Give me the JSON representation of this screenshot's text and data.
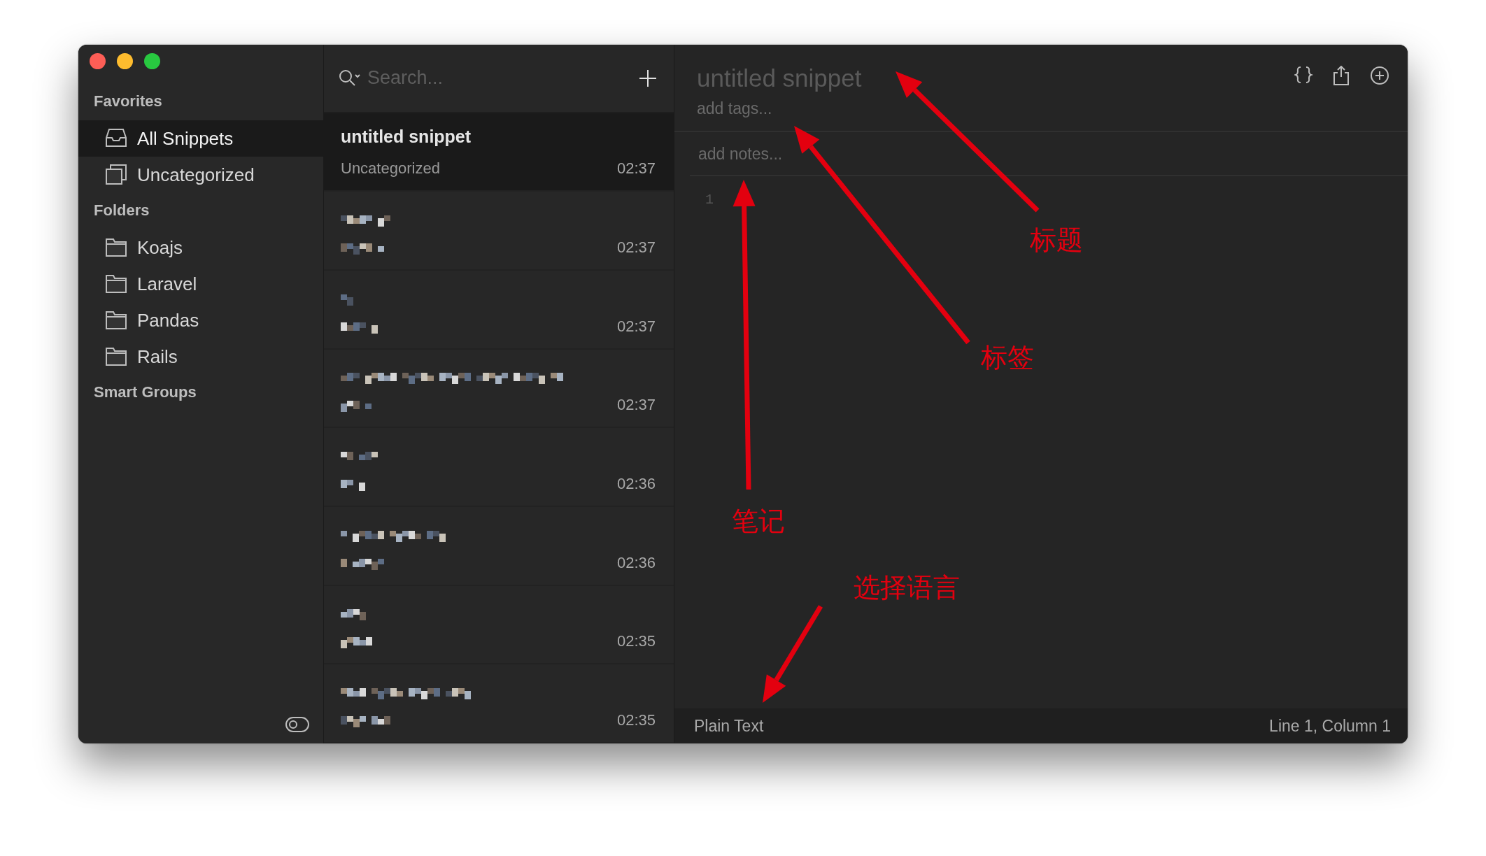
{
  "sidebar": {
    "sections": [
      {
        "title": "Favorites",
        "items": [
          {
            "label": "All Snippets",
            "kind": "all",
            "selected": true
          },
          {
            "label": "Uncategorized",
            "kind": "uncategorized",
            "selected": false
          }
        ]
      },
      {
        "title": "Folders",
        "items": [
          {
            "label": "Koajs",
            "kind": "folder",
            "selected": false
          },
          {
            "label": "Laravel",
            "kind": "folder",
            "selected": false
          },
          {
            "label": "Pandas",
            "kind": "folder",
            "selected": false
          },
          {
            "label": "Rails",
            "kind": "folder",
            "selected": false
          }
        ]
      },
      {
        "title": "Smart Groups"
      }
    ]
  },
  "search": {
    "placeholder": "Search..."
  },
  "snippets": [
    {
      "kind": "text",
      "title": "untitled snippet",
      "folder": "Uncategorized",
      "time": "02:37",
      "selected": true
    },
    {
      "kind": "pixelated",
      "time": "02:37",
      "selected": false
    },
    {
      "kind": "pixelated",
      "time": "02:37",
      "selected": false
    },
    {
      "kind": "pixelated",
      "time": "02:37",
      "selected": false
    },
    {
      "kind": "pixelated",
      "time": "02:36",
      "selected": false
    },
    {
      "kind": "pixelated",
      "time": "02:36",
      "selected": false
    },
    {
      "kind": "pixelated",
      "time": "02:35",
      "selected": false
    },
    {
      "kind": "pixelated",
      "time": "02:35",
      "selected": false
    }
  ],
  "editor": {
    "title_placeholder": "untitled snippet",
    "tags_placeholder": "add tags...",
    "notes_placeholder": "add notes...",
    "line_numbers": [
      "1"
    ]
  },
  "status_bar": {
    "language": "Plain Text",
    "position": "Line 1, Column 1"
  },
  "annotations": [
    {
      "label": "标题"
    },
    {
      "label": "标签"
    },
    {
      "label": "笔记"
    },
    {
      "label": "选择语言"
    }
  ]
}
